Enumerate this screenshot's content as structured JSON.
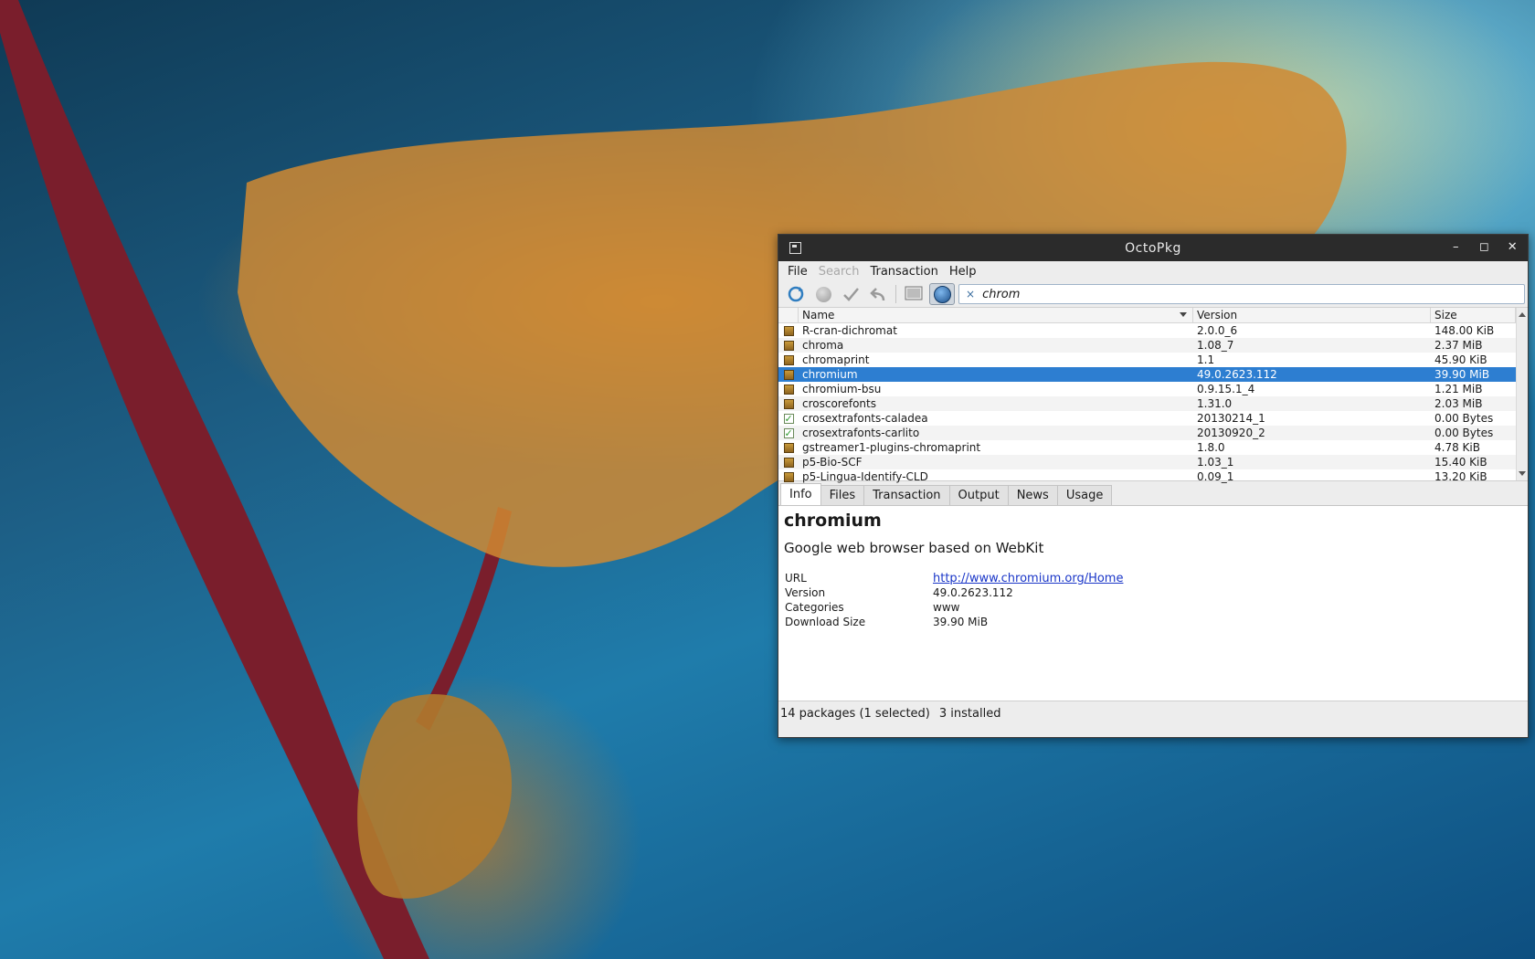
{
  "window": {
    "title": "OctoPkg"
  },
  "menu": [
    "File",
    "Search",
    "Transaction",
    "Help"
  ],
  "search": {
    "value": "chrom"
  },
  "table": {
    "headers": {
      "name": "Name",
      "version": "Version",
      "size": "Size"
    },
    "rows": [
      {
        "name": "R-cran-dichromat",
        "version": "2.0.0_6",
        "size": "148.00 KiB",
        "installed": false
      },
      {
        "name": "chroma",
        "version": "1.08_7",
        "size": "2.37 MiB",
        "installed": false
      },
      {
        "name": "chromaprint",
        "version": "1.1",
        "size": "45.90 KiB",
        "installed": false
      },
      {
        "name": "chromium",
        "version": "49.0.2623.112",
        "size": "39.90 MiB",
        "installed": false,
        "selected": true
      },
      {
        "name": "chromium-bsu",
        "version": "0.9.15.1_4",
        "size": "1.21 MiB",
        "installed": false
      },
      {
        "name": "croscorefonts",
        "version": "1.31.0",
        "size": "2.03 MiB",
        "installed": false
      },
      {
        "name": "crosextrafonts-caladea",
        "version": "20130214_1",
        "size": "0.00 Bytes",
        "installed": true
      },
      {
        "name": "crosextrafonts-carlito",
        "version": "20130920_2",
        "size": "0.00 Bytes",
        "installed": true
      },
      {
        "name": "gstreamer1-plugins-chromaprint",
        "version": "1.8.0",
        "size": "4.78 KiB",
        "installed": false
      },
      {
        "name": "p5-Bio-SCF",
        "version": "1.03_1",
        "size": "15.40 KiB",
        "installed": false
      },
      {
        "name": "p5-Lingua-Identify-CLD",
        "version": "0.09_1",
        "size": "13.20 KiB",
        "installed": false
      }
    ]
  },
  "tabs": [
    "Info",
    "Files",
    "Transaction",
    "Output",
    "News",
    "Usage"
  ],
  "info": {
    "title": "chromium",
    "description": "Google web browser based on WebKit",
    "fields": [
      {
        "key": "URL",
        "value": "http://www.chromium.org/Home",
        "link": true
      },
      {
        "key": "Version",
        "value": "49.0.2623.112"
      },
      {
        "key": "Categories",
        "value": "www"
      },
      {
        "key": "Download Size",
        "value": "39.90 MiB"
      }
    ]
  },
  "status": {
    "packages": "14 packages (1 selected)",
    "installed": "3 installed"
  },
  "colors": {
    "selection": "#2d7ed1",
    "titlebar": "#2b2b2b",
    "link": "#1a36c8"
  }
}
